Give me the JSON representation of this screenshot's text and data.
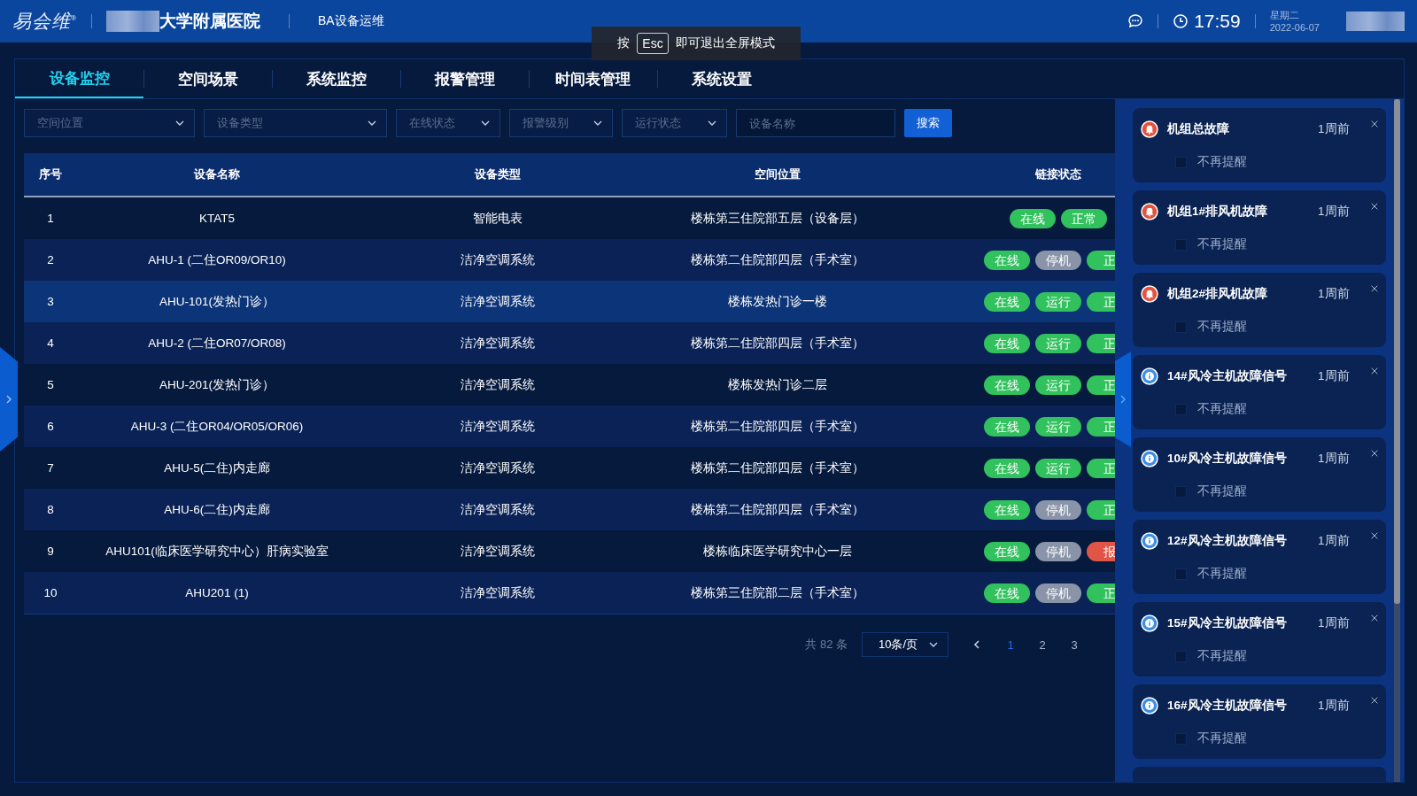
{
  "header": {
    "logo": "易会维",
    "logo_mark": "®",
    "hospital": "大学附属医院",
    "app_title": "BA设备运维",
    "time": "17:59",
    "weekday": "星期二",
    "date": "2022-06-07"
  },
  "toast": {
    "before": "按",
    "key": "Esc",
    "after": "即可退出全屏模式"
  },
  "tabs": [
    {
      "label": "设备监控",
      "selected": true
    },
    {
      "label": "空间场景",
      "selected": false
    },
    {
      "label": "系统监控",
      "selected": false
    },
    {
      "label": "报警管理",
      "selected": false
    },
    {
      "label": "时间表管理",
      "selected": false
    },
    {
      "label": "系统设置",
      "selected": false
    }
  ],
  "filters": [
    {
      "kind": "select",
      "placeholder": "空间位置"
    },
    {
      "kind": "select",
      "placeholder": "设备类型"
    },
    {
      "kind": "select",
      "placeholder": "在线状态"
    },
    {
      "kind": "select",
      "placeholder": "报警级别"
    },
    {
      "kind": "select",
      "placeholder": "运行状态"
    },
    {
      "kind": "input",
      "placeholder": "设备名称"
    }
  ],
  "search_button": "搜索",
  "table": {
    "columns": [
      "序号",
      "设备名称",
      "设备类型",
      "空间位置",
      "链接状态"
    ],
    "rows": [
      {
        "no": "1",
        "name": "KTAT5",
        "type": "智能电表",
        "location": "楼栋第三住院部五层（设备层）",
        "selected": false,
        "tags": [
          {
            "kind": "ok",
            "text": "在线"
          },
          {
            "kind": "ok",
            "text": "正常"
          }
        ]
      },
      {
        "no": "2",
        "name": "AHU-1 (二住OR09/OR10)",
        "type": "洁净空调系统",
        "location": "楼栋第二住院部四层（手术室）",
        "selected": false,
        "tags": [
          {
            "kind": "ok",
            "text": "在线"
          },
          {
            "kind": "off",
            "text": "停机"
          },
          {
            "kind": "ok",
            "text": "正"
          }
        ]
      },
      {
        "no": "3",
        "name": "AHU-101(发热门诊）",
        "type": "洁净空调系统",
        "location": "楼栋发热门诊一楼",
        "selected": true,
        "tags": [
          {
            "kind": "ok",
            "text": "在线"
          },
          {
            "kind": "ok",
            "text": "运行"
          },
          {
            "kind": "ok",
            "text": "正"
          }
        ]
      },
      {
        "no": "4",
        "name": "AHU-2 (二住OR07/OR08)",
        "type": "洁净空调系统",
        "location": "楼栋第二住院部四层（手术室）",
        "selected": false,
        "tags": [
          {
            "kind": "ok",
            "text": "在线"
          },
          {
            "kind": "ok",
            "text": "运行"
          },
          {
            "kind": "ok",
            "text": "正"
          }
        ]
      },
      {
        "no": "5",
        "name": "AHU-201(发热门诊）",
        "type": "洁净空调系统",
        "location": "楼栋发热门诊二层",
        "selected": false,
        "tags": [
          {
            "kind": "ok",
            "text": "在线"
          },
          {
            "kind": "ok",
            "text": "运行"
          },
          {
            "kind": "ok",
            "text": "正"
          }
        ]
      },
      {
        "no": "6",
        "name": "AHU-3 (二住OR04/OR05/OR06)",
        "type": "洁净空调系统",
        "location": "楼栋第二住院部四层（手术室）",
        "selected": false,
        "tags": [
          {
            "kind": "ok",
            "text": "在线"
          },
          {
            "kind": "ok",
            "text": "运行"
          },
          {
            "kind": "ok",
            "text": "正"
          }
        ]
      },
      {
        "no": "7",
        "name": "AHU-5(二住)内走廊",
        "type": "洁净空调系统",
        "location": "楼栋第二住院部四层（手术室）",
        "selected": false,
        "tags": [
          {
            "kind": "ok",
            "text": "在线"
          },
          {
            "kind": "ok",
            "text": "运行"
          },
          {
            "kind": "ok",
            "text": "正"
          }
        ]
      },
      {
        "no": "8",
        "name": "AHU-6(二住)内走廊",
        "type": "洁净空调系统",
        "location": "楼栋第二住院部四层（手术室）",
        "selected": false,
        "tags": [
          {
            "kind": "ok",
            "text": "在线"
          },
          {
            "kind": "off",
            "text": "停机"
          },
          {
            "kind": "ok",
            "text": "正"
          }
        ]
      },
      {
        "no": "9",
        "name": "AHU101(临床医学研究中心）肝病实验室",
        "type": "洁净空调系统",
        "location": "楼栋临床医学研究中心一层",
        "selected": false,
        "tags": [
          {
            "kind": "ok",
            "text": "在线"
          },
          {
            "kind": "off",
            "text": "停机"
          },
          {
            "kind": "alarm",
            "text": "报"
          }
        ]
      },
      {
        "no": "10",
        "name": "AHU201 (1)",
        "type": "洁净空调系统",
        "location": "楼栋第三住院部二层（手术室）",
        "selected": false,
        "tags": [
          {
            "kind": "ok",
            "text": "在线"
          },
          {
            "kind": "off",
            "text": "停机"
          },
          {
            "kind": "ok",
            "text": "正"
          }
        ]
      }
    ]
  },
  "pagination": {
    "total": "共 82 条",
    "page_size": "10条/页",
    "pages": [
      {
        "label": "1",
        "selected": true
      },
      {
        "label": "2",
        "selected": false
      },
      {
        "label": "3",
        "selected": false
      }
    ]
  },
  "notifications": [
    {
      "kind": "alarm",
      "title": "机组总故障",
      "time": "1周前",
      "option": "不再提醒",
      "checked": false
    },
    {
      "kind": "alarm",
      "title": "机组1#排风机故障",
      "time": "1周前",
      "option": "不再提醒",
      "checked": false
    },
    {
      "kind": "alarm",
      "title": "机组2#排风机故障",
      "time": "1周前",
      "option": "不再提醒",
      "checked": false
    },
    {
      "kind": "info",
      "title": "14#风冷主机故障信号",
      "time": "1周前",
      "option": "不再提醒",
      "checked": false
    },
    {
      "kind": "info",
      "title": "10#风冷主机故障信号",
      "time": "1周前",
      "option": "不再提醒",
      "checked": false
    },
    {
      "kind": "info",
      "title": "12#风冷主机故障信号",
      "time": "1周前",
      "option": "不再提醒",
      "checked": false
    },
    {
      "kind": "info",
      "title": "15#风冷主机故障信号",
      "time": "1周前",
      "option": "不再提醒",
      "checked": false
    },
    {
      "kind": "info",
      "title": "16#风冷主机故障信号",
      "time": "1周前",
      "option": "不再提醒",
      "checked": false
    }
  ]
}
